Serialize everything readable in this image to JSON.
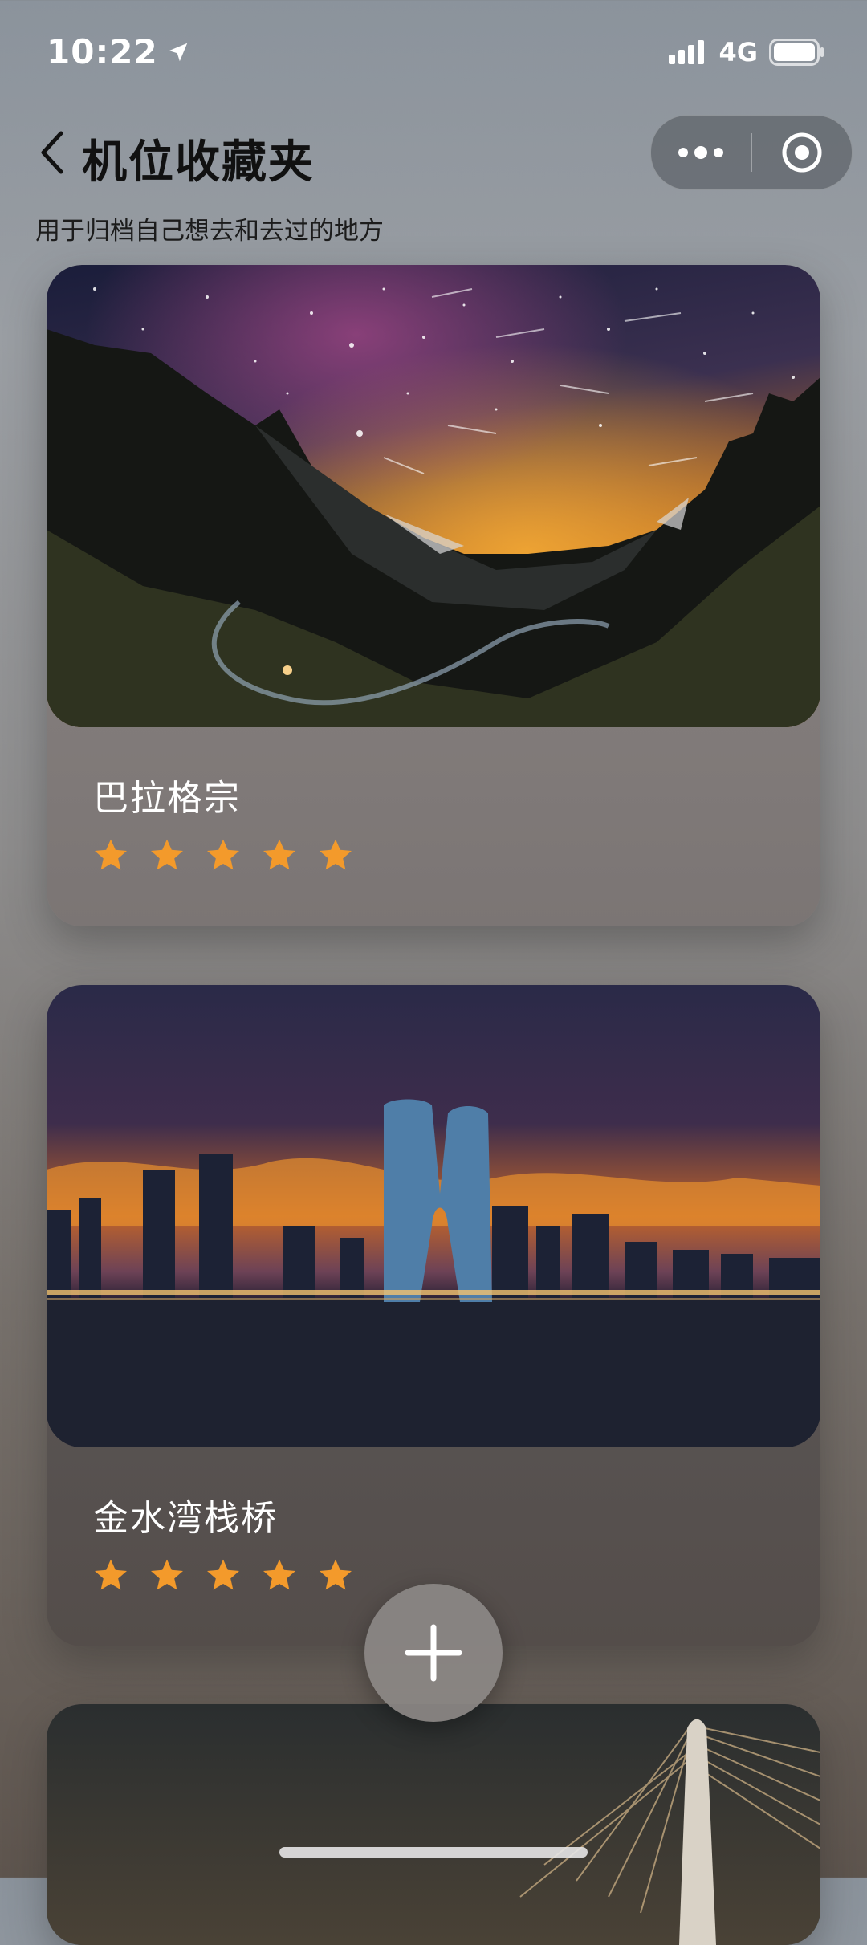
{
  "status_bar": {
    "time": "10:22",
    "network": "4G",
    "icons": [
      "location-arrow-icon",
      "signal-icon",
      "battery-icon"
    ]
  },
  "header": {
    "title": "机位收藏夹",
    "subtitle": "用于归档自己想去和去过的地方",
    "icons": [
      "chevron-left-icon",
      "more-dots-icon",
      "target-icon"
    ]
  },
  "places": [
    {
      "name": "巴拉格宗",
      "rating": 5,
      "rating_max": 5,
      "image": "starry-mountain-photo"
    },
    {
      "name": "金水湾栈桥",
      "rating": 5,
      "rating_max": 5,
      "image": "city-skyline-sunset-photo"
    },
    {
      "name": "",
      "image": "cable-bridge-night-photo"
    }
  ],
  "fab": {
    "icon": "plus-icon"
  },
  "colors": {
    "star": "#f39a2b",
    "title_text": "#111111",
    "card_text": "#ffffff"
  }
}
